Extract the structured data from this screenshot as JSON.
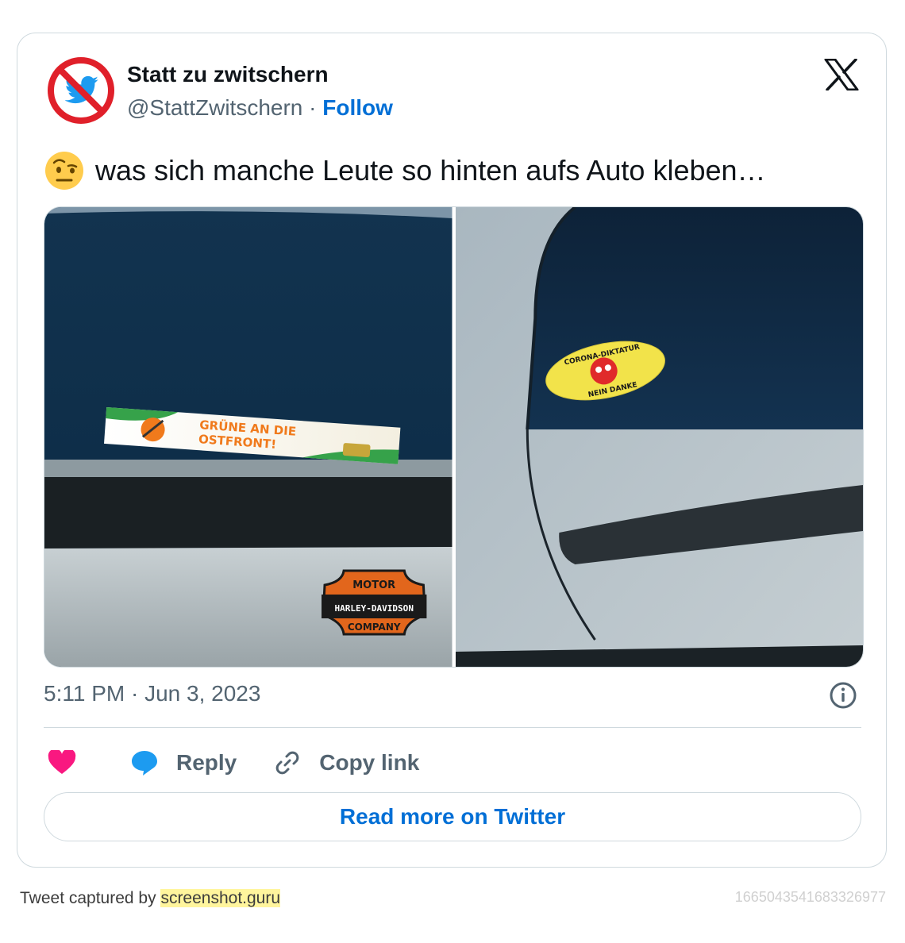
{
  "author": {
    "name": "Statt zu zwitschern",
    "handle": "@StattZwitschern",
    "separator": " · ",
    "follow_label": "Follow"
  },
  "tweet": {
    "emoji": "face-with-raised-eyebrow",
    "text": "was sich manche Leute so hinten aufs Auto kleben…",
    "timestamp": "5:11 PM · Jun 3, 2023"
  },
  "media": {
    "photo1": {
      "sticker_line1": "GRÜNE AN DIE",
      "sticker_line2": "OSTFRONT!",
      "logo_top": "MOTOR",
      "logo_middle": "HARLEY-DAVIDSON",
      "logo_bottom": "COMPANY"
    },
    "photo2": {
      "sticker_top": "CORONA-DIKTATUR",
      "sticker_bottom": "NEIN DANKE"
    }
  },
  "actions": {
    "reply_label": "Reply",
    "copy_link_label": "Copy link",
    "read_more_label": "Read more on Twitter"
  },
  "footer": {
    "captured_by": "Tweet captured by ",
    "link_text": "screenshot.guru",
    "tweet_id": "1665043541683326977"
  },
  "colors": {
    "accent": "#006fd6",
    "heart": "#f91880",
    "reply_bubble": "#1d9bf0",
    "twitter_blue": "#1d9bf0",
    "ban_red": "#e0202a"
  }
}
